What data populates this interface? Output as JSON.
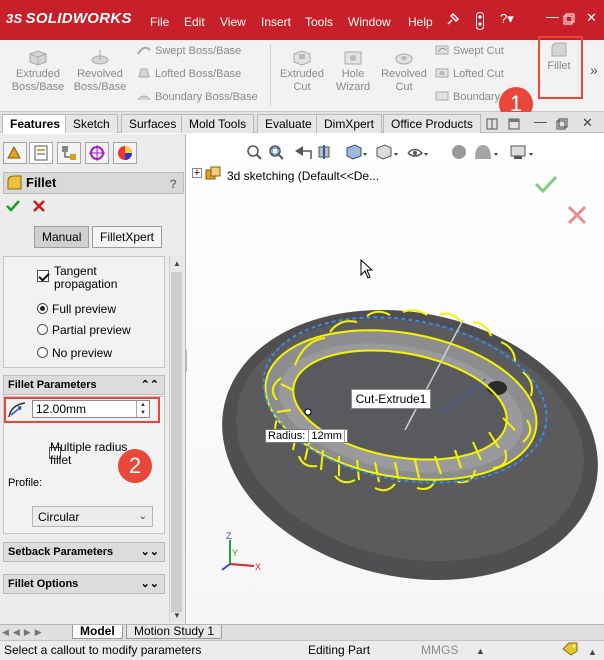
{
  "app": {
    "logo_ds": "3S",
    "logo_text": "SOLIDWORKS"
  },
  "menu": [
    "File",
    "Edit",
    "View",
    "Insert",
    "Tools",
    "Window",
    "Help"
  ],
  "ribbon": {
    "extruded_boss": "Extruded Boss/Base",
    "revolved_boss": "Revolved Boss/Base",
    "swept_boss": "Swept Boss/Base",
    "lofted_boss": "Lofted Boss/Base",
    "boundary_boss": "Boundary Boss/Base",
    "extruded_cut": "Extruded Cut",
    "hole_wizard": "Hole Wizard",
    "revolved_cut": "Revolved Cut",
    "swept_cut": "Swept Cut",
    "lofted_cut": "Lofted Cut",
    "boundary_cut": "Boundary",
    "fillet": "Fillet",
    "more": "»"
  },
  "tabs": [
    "Features",
    "Sketch",
    "Surfaces",
    "Mold Tools",
    "Evaluate",
    "DimXpert",
    "Office Products"
  ],
  "panel": {
    "title": "Fillet",
    "help": "?",
    "manual": "Manual",
    "filletxpert": "FilletXpert",
    "tangent_line1": "Tangent",
    "tangent_line2": "propagation",
    "full_preview": "Full preview",
    "partial_preview": "Partial preview",
    "no_preview": "No preview",
    "fillet_params": "Fillet Parameters",
    "radius_value": "12.00mm",
    "multiple_radius_line1": "Multiple radius",
    "multiple_radius_line2": "fillet",
    "profile_label": "Profile:",
    "profile_value": "Circular",
    "setback_params": "Setback Parameters",
    "fillet_options": "Fillet Options"
  },
  "viewport": {
    "tree_label": "3d sketching  (Default<<De...",
    "cut_extrude": "Cut-Extrude1",
    "radius_label": "Radius:",
    "radius_value": "12mm",
    "axis_x": "X",
    "axis_y": "Y",
    "axis_z": "Z"
  },
  "bottom_tabs": [
    "Model",
    "Motion Study 1"
  ],
  "status": {
    "message": "Select a callout to modify parameters",
    "mode": "Editing Part",
    "units": "MMGS"
  },
  "callouts": [
    "1",
    "2"
  ],
  "colors": {
    "titlebar": "#c8202a",
    "callout": "#e8473a",
    "highlight_edge": "#f5f500"
  }
}
